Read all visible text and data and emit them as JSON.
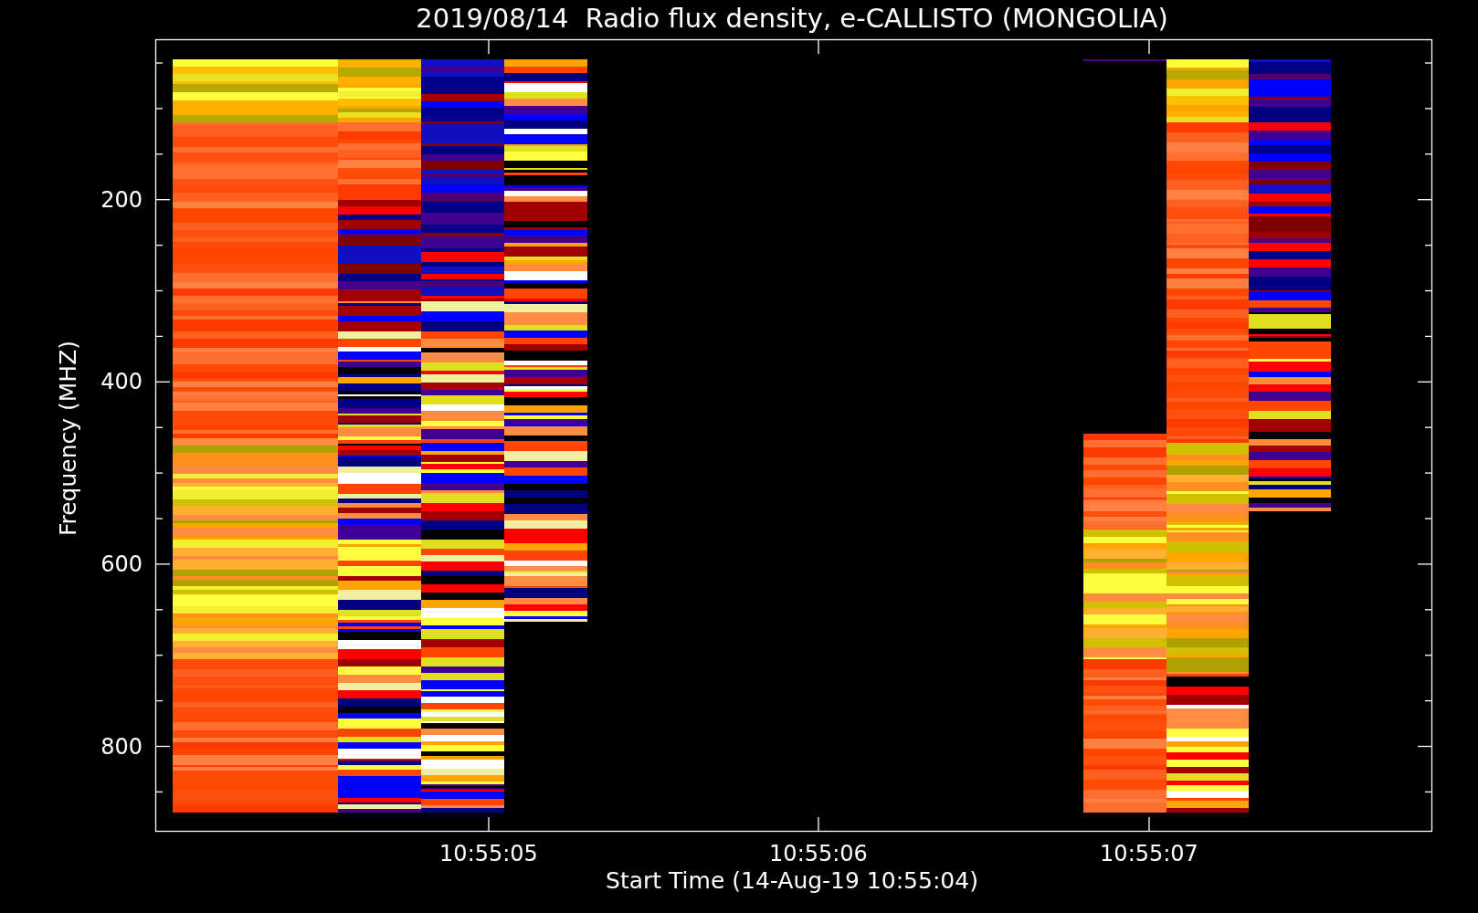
{
  "title": "2019/08/14  Radio flux density, e-CALLISTO (MONGOLIA)",
  "plot": {
    "ylabel": "Frequency (MHZ)",
    "xlabel": "Start Time (14-Aug-19 10:55:04)",
    "yticks": [
      "200",
      "400",
      "600",
      "800"
    ],
    "xticks": [
      "10:55:05",
      "10:55:06",
      "10:55:07"
    ]
  }
}
